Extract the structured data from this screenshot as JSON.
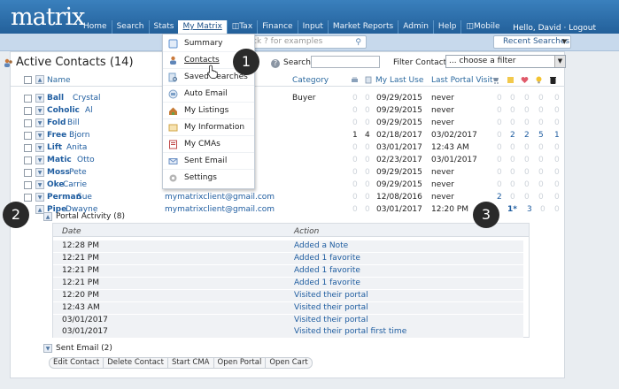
{
  "app": {
    "logo": "matrix"
  },
  "nav": {
    "items": [
      {
        "label": "Home"
      },
      {
        "label": "Search"
      },
      {
        "label": "Stats"
      },
      {
        "label": "My Matrix",
        "active": true
      },
      {
        "label": "Tax"
      },
      {
        "label": "Finance"
      },
      {
        "label": "Input"
      },
      {
        "label": "Market Reports"
      },
      {
        "label": "Admin"
      },
      {
        "label": "Help"
      },
      {
        "label": "Mobile"
      }
    ],
    "user": "Hello, David · Logout"
  },
  "quick_search": {
    "placeholder": "ck ? for examples"
  },
  "recent_searches": {
    "label": "Recent Searches"
  },
  "page": {
    "title": "Active Contacts (14)",
    "search_label": "Search:",
    "filter_label": "Filter Contacts:",
    "filter_value": "... choose a filter"
  },
  "table": {
    "headers": {
      "name": "Name",
      "category": "Category",
      "my_last_use": "My Last Use",
      "last_portal_visit": "Last Portal Visit"
    },
    "rows": [
      {
        "last": "Ball",
        "first": "Crystal",
        "email": "",
        "category": "Buyer",
        "c1": "0",
        "c2": "0",
        "my_last_use": "09/29/2015",
        "last_visit": "never",
        "s1": "0",
        "s2": "0",
        "s3": "0",
        "s4": "0",
        "s5": "0"
      },
      {
        "last": "Coholic",
        "first": "Al",
        "email": "",
        "category": "",
        "c1": "0",
        "c2": "0",
        "my_last_use": "09/29/2015",
        "last_visit": "never",
        "s1": "0",
        "s2": "0",
        "s3": "0",
        "s4": "0",
        "s5": "0"
      },
      {
        "last": "Fold",
        "first": "Bill",
        "email": "",
        "category": "",
        "c1": "0",
        "c2": "0",
        "my_last_use": "09/29/2015",
        "last_visit": "never",
        "s1": "0",
        "s2": "0",
        "s3": "0",
        "s4": "0",
        "s5": "0"
      },
      {
        "last": "Free",
        "first": "Bjorn",
        "email": "",
        "category": "",
        "c1": "1",
        "c2": "4",
        "my_last_use": "02/18/2017",
        "last_visit": "03/02/2017",
        "s1": "0",
        "s2": "2",
        "s3": "2",
        "s4": "5",
        "s5": "1"
      },
      {
        "last": "Lift",
        "first": "Anita",
        "email": "",
        "category": "",
        "c1": "0",
        "c2": "0",
        "my_last_use": "03/01/2017",
        "last_visit": "12:43 AM",
        "s1": "0",
        "s2": "0",
        "s3": "0",
        "s4": "0",
        "s5": "0"
      },
      {
        "last": "Matic",
        "first": "Otto",
        "email": "",
        "category": "",
        "c1": "0",
        "c2": "0",
        "my_last_use": "02/23/2017",
        "last_visit": "03/01/2017",
        "s1": "0",
        "s2": "0",
        "s3": "0",
        "s4": "0",
        "s5": "0"
      },
      {
        "last": "Moss",
        "first": "Pete",
        "email": "",
        "category": "",
        "c1": "0",
        "c2": "0",
        "my_last_use": "09/29/2015",
        "last_visit": "never",
        "s1": "0",
        "s2": "0",
        "s3": "0",
        "s4": "0",
        "s5": "0"
      },
      {
        "last": "Oke",
        "first": "Carrie",
        "email": "",
        "category": "",
        "c1": "0",
        "c2": "0",
        "my_last_use": "09/29/2015",
        "last_visit": "never",
        "s1": "0",
        "s2": "0",
        "s3": "0",
        "s4": "0",
        "s5": "0"
      },
      {
        "last": "Perman",
        "first": "Sue",
        "email": "mymatrixclient@gmail.com",
        "category": "",
        "c1": "0",
        "c2": "0",
        "my_last_use": "12/08/2016",
        "last_visit": "never",
        "s1": "2",
        "s2": "0",
        "s3": "0",
        "s4": "0",
        "s5": "0"
      },
      {
        "last": "Pipe",
        "first": "Dwayne",
        "email": "mymatrixclient@gmail.com",
        "category": "",
        "c1": "0",
        "c2": "0",
        "my_last_use": "03/01/2017",
        "last_visit": "12:20 PM",
        "s1": "",
        "s2": "1*",
        "s3": "3",
        "s4": "0",
        "s5": "0"
      }
    ]
  },
  "dropdown": {
    "items": [
      {
        "label": "Summary",
        "icon": "summary-icon",
        "color": "#5b8fd0"
      },
      {
        "label": "Contacts",
        "icon": "contacts-icon",
        "color": "#c9793c"
      },
      {
        "label": "Saved Searches",
        "icon": "saved-searches-icon",
        "color": "#7aa0c8"
      },
      {
        "label": "Auto Email",
        "icon": "auto-email-icon",
        "color": "#7a9ec6"
      },
      {
        "label": "My Listings",
        "icon": "listings-icon",
        "color": "#c57a34"
      },
      {
        "label": "My Information",
        "icon": "information-icon",
        "color": "#d0a545"
      },
      {
        "label": "My CMAs",
        "icon": "cma-icon",
        "color": "#c04848"
      },
      {
        "label": "Sent Email",
        "icon": "sent-email-icon",
        "color": "#6b90c4"
      },
      {
        "label": "Settings",
        "icon": "settings-icon",
        "color": "#8c8c8c"
      }
    ]
  },
  "callouts": [
    "1",
    "2",
    "3"
  ],
  "portal_activity": {
    "title": "Portal Activity (8)",
    "headers": {
      "date": "Date",
      "action": "Action"
    },
    "rows": [
      {
        "date": "12:28 PM",
        "action": "Added a Note"
      },
      {
        "date": "12:21 PM",
        "action": "Added 1 favorite"
      },
      {
        "date": "12:21 PM",
        "action": "Added 1 favorite"
      },
      {
        "date": "12:21 PM",
        "action": "Added 1 favorite"
      },
      {
        "date": "12:20 PM",
        "action": "Visited their portal"
      },
      {
        "date": "12:43 AM",
        "action": "Visited their portal"
      },
      {
        "date": "03/01/2017",
        "action": "Visited their portal"
      },
      {
        "date": "03/01/2017",
        "action": "Visited their portal first time"
      }
    ]
  },
  "sent_email": {
    "title": "Sent Email (2)"
  },
  "actions": [
    {
      "label": "Edit Contact"
    },
    {
      "label": "Delete Contact"
    },
    {
      "label": "Start CMA"
    },
    {
      "label": "Open Portal"
    },
    {
      "label": "Open Cart"
    }
  ]
}
